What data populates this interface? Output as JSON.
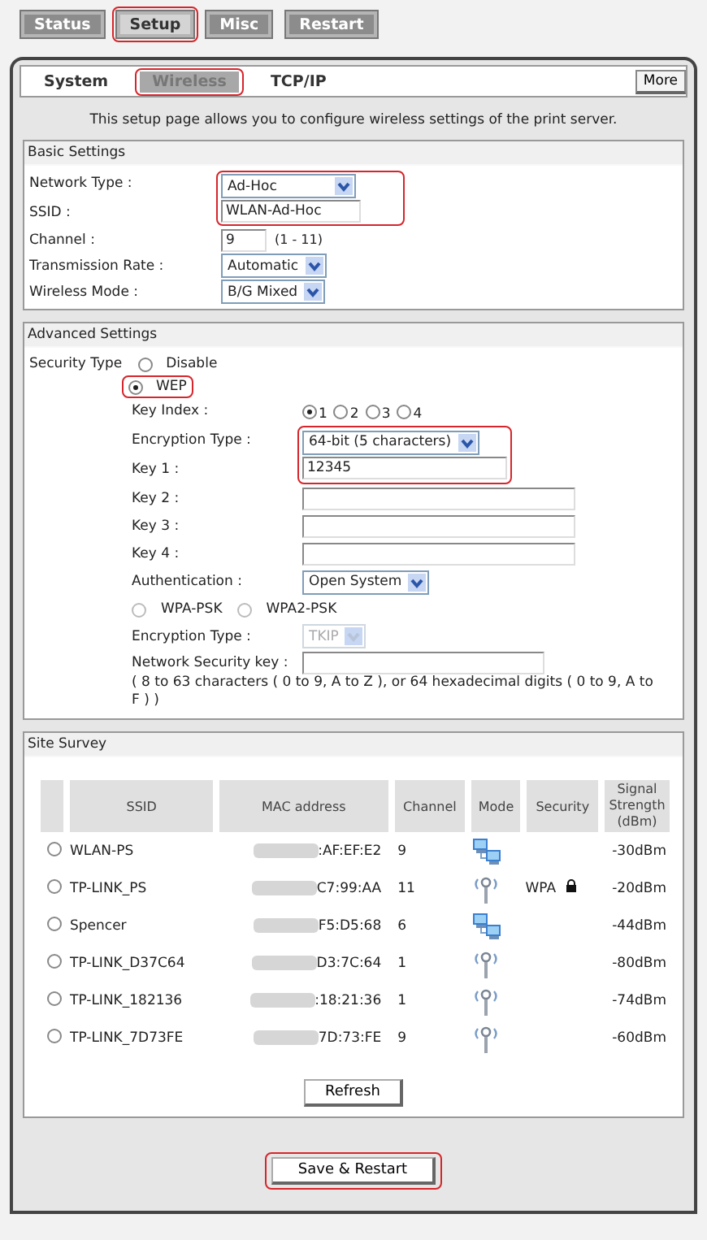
{
  "top_tabs": [
    {
      "label": "Status",
      "selected": false,
      "highlighted": false
    },
    {
      "label": "Setup",
      "selected": true,
      "highlighted": true
    },
    {
      "label": "Misc",
      "selected": false,
      "highlighted": false
    },
    {
      "label": "Restart",
      "selected": false,
      "highlighted": false
    }
  ],
  "sub_tabs": [
    {
      "label": "System",
      "selected": false,
      "highlighted": false
    },
    {
      "label": "Wireless",
      "selected": true,
      "highlighted": true
    },
    {
      "label": "TCP/IP",
      "selected": false,
      "highlighted": false
    }
  ],
  "more_button": "More",
  "intro": "This setup page allows you to configure wireless settings of the print server.",
  "basic_settings": {
    "title": "Basic Settings",
    "fields": [
      {
        "kind": "select",
        "label": "Network Type :",
        "value": "Ad-Hoc",
        "highlighted": true
      },
      {
        "kind": "text",
        "label": "SSID :",
        "value": "WLAN-Ad-Hoc",
        "highlighted": true
      },
      {
        "kind": "text",
        "label": "Channel :",
        "value": "9",
        "hint": "(1 - 11)",
        "highlighted": false
      },
      {
        "kind": "select",
        "label": "Transmission Rate :",
        "value": "Automatic",
        "highlighted": false
      },
      {
        "kind": "select",
        "label": "Wireless Mode :",
        "value": "B/G Mixed",
        "highlighted": false
      }
    ]
  },
  "advanced_settings": {
    "title": "Advanced Settings",
    "security_label": "Security Type",
    "security_options": [
      {
        "label": "Disable",
        "selected": false,
        "highlighted": false
      },
      {
        "label": "WEP",
        "selected": true,
        "highlighted": true
      }
    ],
    "wep_fields": [
      {
        "kind": "radios",
        "label": "Key Index :",
        "highlighted": false,
        "options": [
          {
            "label": "1",
            "selected": true
          },
          {
            "label": "2",
            "selected": false
          },
          {
            "label": "3",
            "selected": false
          },
          {
            "label": "4",
            "selected": false
          }
        ]
      },
      {
        "kind": "select",
        "label": "Encryption Type :",
        "value": "64-bit (5 characters)",
        "highlighted": true
      },
      {
        "kind": "text",
        "label": "Key 1 :",
        "value": "12345",
        "highlighted": true
      },
      {
        "kind": "text",
        "label": "Key 2 :",
        "highlighted": false
      },
      {
        "kind": "text",
        "label": "Key 3 :",
        "highlighted": false
      },
      {
        "kind": "text",
        "label": "Key 4 :",
        "highlighted": false
      },
      {
        "kind": "select",
        "label": "Authentication :",
        "value": "Open System",
        "highlighted": false
      }
    ],
    "wpa_options": [
      {
        "label": "WPA-PSK",
        "selected": false
      },
      {
        "label": "WPA2-PSK",
        "selected": false
      }
    ],
    "wpa_fields": [
      {
        "kind": "select",
        "label": "Encryption Type :",
        "value": "TKIP",
        "disabled": true,
        "highlighted": false
      },
      {
        "kind": "text",
        "label": "Network Security key :",
        "disabled": false,
        "highlighted": false
      }
    ],
    "note": "( 8 to 63 characters ( 0 to 9, A to Z ), or 64 hexadecimal digits ( 0 to 9, A to F ) )"
  },
  "site_survey": {
    "title": "Site Survey",
    "columns": [
      "SSID",
      "MAC address",
      "Channel",
      "Mode",
      "Security",
      "Signal Strength (dBm)"
    ],
    "rows": [
      {
        "selected": false,
        "ssid": "WLAN-PS",
        "mac": ":AF:EF:E2",
        "channel": "9",
        "kind": "adhoc",
        "locked": false,
        "signal": "-30dBm"
      },
      {
        "selected": false,
        "ssid": "TP-LINK_PS",
        "mac": "C7:99:AA",
        "channel": "11",
        "kind": "infrastructure",
        "security": "WPA",
        "locked": true,
        "signal": "-20dBm"
      },
      {
        "selected": false,
        "ssid": "Spencer",
        "mac": "F5:D5:68",
        "channel": "6",
        "kind": "adhoc",
        "locked": false,
        "signal": "-44dBm"
      },
      {
        "selected": false,
        "ssid": "TP-LINK_D37C64",
        "mac": "D3:7C:64",
        "channel": "1",
        "kind": "infrastructure",
        "locked": false,
        "signal": "-80dBm"
      },
      {
        "selected": false,
        "ssid": "TP-LINK_182136",
        "mac": ":18:21:36",
        "channel": "1",
        "kind": "infrastructure",
        "locked": false,
        "signal": "-74dBm"
      },
      {
        "selected": false,
        "ssid": "TP-LINK_7D73FE",
        "mac": "7D:73:FE",
        "channel": "9",
        "kind": "infrastructure",
        "locked": false,
        "signal": "-60dBm"
      }
    ],
    "refresh_button": "Refresh"
  },
  "save_button": {
    "label": "Save & Restart",
    "highlighted": true
  }
}
